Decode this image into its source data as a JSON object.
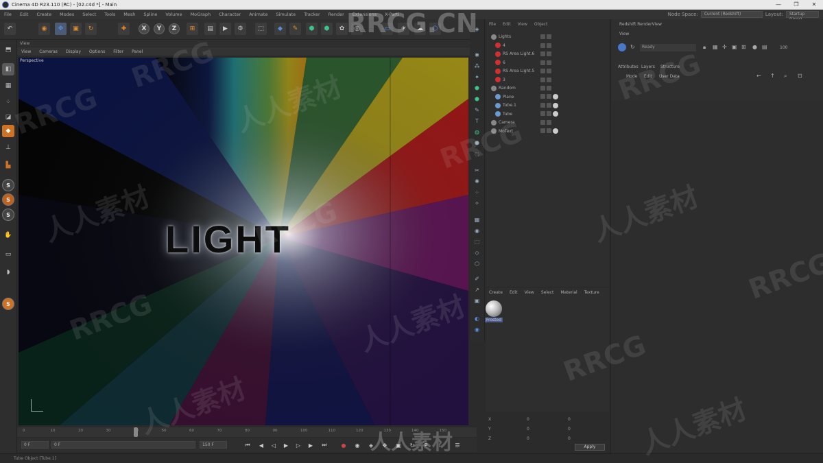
{
  "window": {
    "title": "Cinema 4D R23.110 (RC) - [02.c4d *] - Main",
    "controls": [
      "—",
      "❐",
      "✕"
    ]
  },
  "menubar": {
    "items": [
      "File",
      "Edit",
      "Create",
      "Modes",
      "Select",
      "Tools",
      "Mesh",
      "Spline",
      "Volume",
      "MoGraph",
      "Character",
      "Animate",
      "Simulate",
      "Tracker",
      "Render",
      "Extensions",
      "X-Parti"
    ],
    "node_space_label": "Node Space:",
    "node_space_value": "Current (Redshift)",
    "layout_label": "Layout:",
    "layout_value": "Startup (User)"
  },
  "toolbar": {
    "axis_labels": [
      "X",
      "Y",
      "Z"
    ]
  },
  "left_tools": {
    "ring_labels": [
      "S",
      "S",
      "S",
      "S"
    ]
  },
  "viewport": {
    "panel_title": "View",
    "menu": [
      "View",
      "Cameras",
      "Display",
      "Options",
      "Filter",
      "Panel"
    ],
    "camera_label": "Perspective",
    "scene_text": "LIGHT"
  },
  "timeline": {
    "ticks": [
      "0",
      "10",
      "20",
      "30",
      "40",
      "50",
      "60",
      "70",
      "80",
      "90",
      "100",
      "110",
      "120",
      "130",
      "140",
      "150"
    ],
    "start_frame": "0 F",
    "current_frame": "0 F",
    "end_frame": "150 F",
    "end_frame_2": "150"
  },
  "status_bar": {
    "text": "Tube Object [Tube.1]"
  },
  "object_manager": {
    "tabs": [
      "File",
      "Edit",
      "View",
      "Object"
    ],
    "objects": [
      {
        "name": "Lights",
        "color": "#888888",
        "material": false
      },
      {
        "name": "4",
        "color": "#d23030",
        "material": false
      },
      {
        "name": "RS Area Light.6",
        "color": "#d23030",
        "material": false
      },
      {
        "name": "6",
        "color": "#d23030",
        "material": false
      },
      {
        "name": "RS Area Light.5",
        "color": "#d23030",
        "material": false
      },
      {
        "name": "3",
        "color": "#d23030",
        "material": false
      },
      {
        "name": "Random",
        "color": "#888888",
        "material": false
      },
      {
        "name": "Plane",
        "color": "#6a9ad0",
        "material": true
      },
      {
        "name": "Tube.1",
        "color": "#6a9ad0",
        "material": true
      },
      {
        "name": "Tube",
        "color": "#6a9ad0",
        "material": true
      },
      {
        "name": "Camera",
        "color": "#888888",
        "material": false
      },
      {
        "name": "MoText",
        "color": "#888888",
        "material": true
      }
    ]
  },
  "material_manager": {
    "menu": [
      "Create",
      "Edit",
      "View",
      "Select",
      "Material",
      "Texture"
    ],
    "material_name": "Frosted"
  },
  "coordinates": {
    "labels": [
      "X",
      "Y",
      "Z"
    ],
    "values": [
      "0",
      "0",
      "0"
    ],
    "apply_label": "Apply"
  },
  "right_panel": {
    "render_view_title": "Redshift RenderView",
    "view_label": "View",
    "render_status": "Ready",
    "zoom": "100",
    "attributes_tab": "Attributes",
    "layers_tab": "Layers",
    "structure_tab": "Structure",
    "attr_menu": [
      "Mode",
      "Edit",
      "User Data"
    ]
  },
  "watermarks": [
    "RRCG.CN",
    "RRCG",
    "人人素材"
  ],
  "colors": {
    "accent_blue": "#4a78c8",
    "light_red": "#d23030"
  }
}
